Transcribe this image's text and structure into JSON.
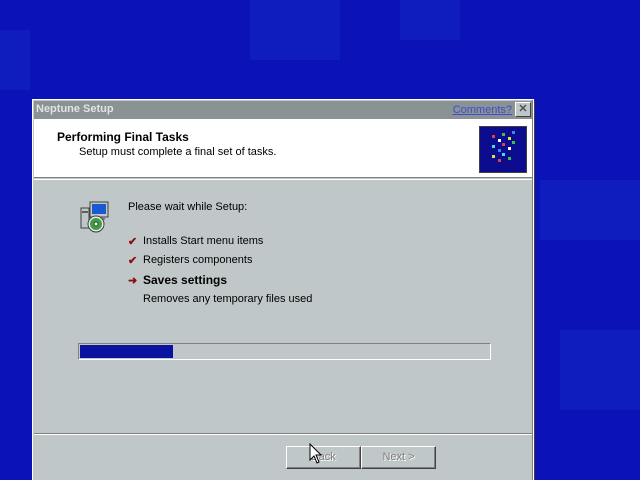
{
  "window": {
    "title": "Neptune Setup",
    "comments_link": "Comments?",
    "close_glyph": "✕"
  },
  "header": {
    "title": "Performing Final Tasks",
    "subtitle": "Setup must complete a final set of tasks."
  },
  "body": {
    "intro": "Please wait while Setup:",
    "tasks": [
      {
        "label": "Installs Start menu items",
        "state": "done",
        "mark": "✔"
      },
      {
        "label": "Registers components",
        "state": "done",
        "mark": "✔"
      },
      {
        "label": "Saves settings",
        "state": "current",
        "mark": "➜"
      },
      {
        "label": "Removes any temporary files used",
        "state": "pending",
        "mark": ""
      }
    ],
    "progress_fraction": 0.23
  },
  "buttons": {
    "back_label": "Back",
    "next_label": "Next >",
    "back_enabled": false,
    "next_enabled": false
  },
  "colors": {
    "desktop": "#0a12b8",
    "progress_fill": "#0a12a0",
    "check_mark": "#8a1010"
  },
  "icons": {
    "installer": "computer-with-cd-icon",
    "logo": "neptune-logo-icon",
    "cursor": "mouse-pointer-icon"
  }
}
